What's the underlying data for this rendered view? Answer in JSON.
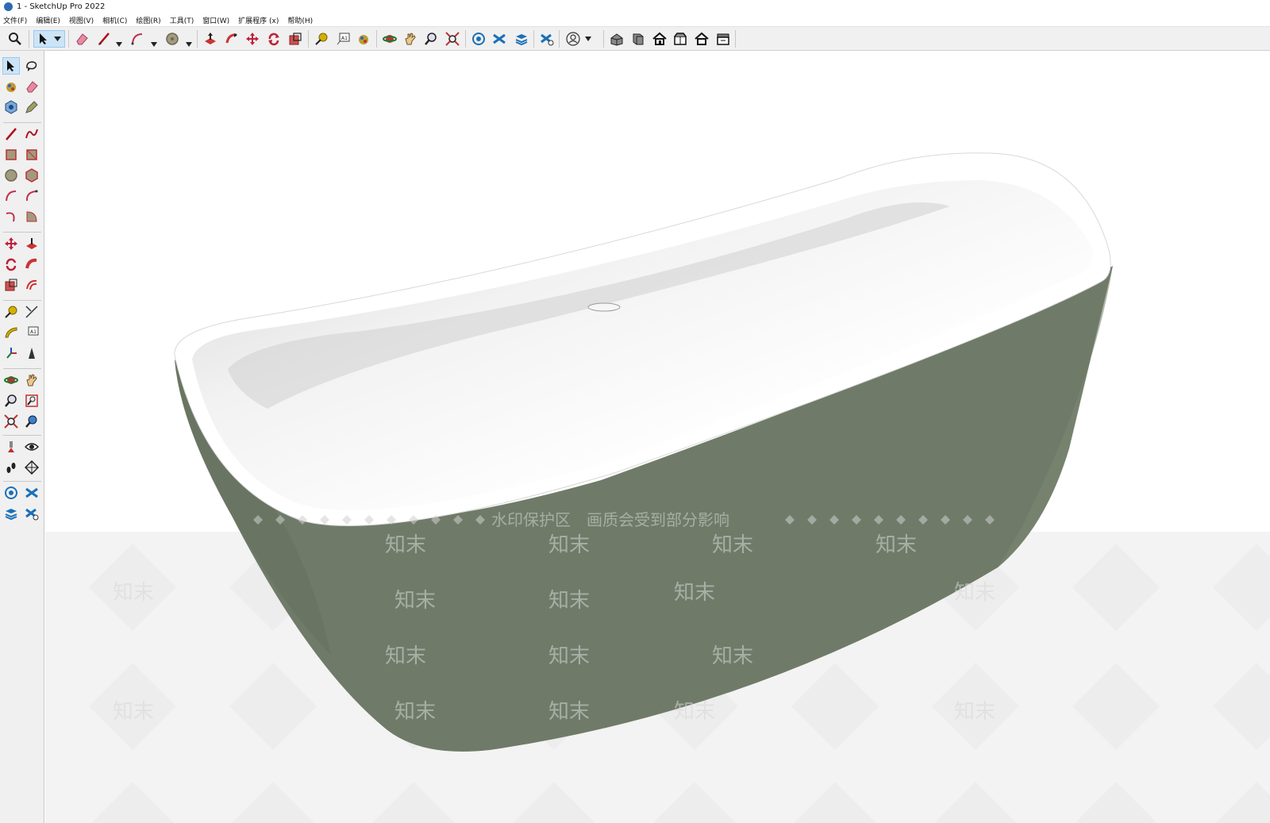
{
  "window": {
    "title": "1 - SketchUp Pro 2022"
  },
  "menu": [
    "文件(F)",
    "编辑(E)",
    "视图(V)",
    "相机(C)",
    "绘图(R)",
    "工具(T)",
    "窗口(W)",
    "扩展程序 (x)",
    "帮助(H)"
  ],
  "toolbar_icons": [
    "search-icon",
    "select-icon",
    "eraser-icon",
    "line-icon",
    "arc-icon",
    "paint-bucket-icon",
    "push-pull-icon",
    "follow-me-icon",
    "move-icon",
    "rotate-icon",
    "scale-icon",
    "tape-measure-icon",
    "text-icon",
    "paint-icon",
    "orbit-icon",
    "pan-icon",
    "zoom-icon",
    "zoom-extents-icon",
    "warehouse-icon",
    "extension-icon",
    "layers-icon",
    "sandbox-icon",
    "profile-icon",
    "iso-view-icon",
    "front-view-icon",
    "home-view-icon",
    "top-view-icon",
    "house-icon",
    "back-view-icon"
  ],
  "colors": {
    "tub_body": "#6f7b68",
    "tub_inner": "#ffffff",
    "ground": "#f3f3f3",
    "toolbar_bg": "#f0f0f0",
    "select_highlight": "#cce4f7"
  },
  "watermark": {
    "banner": "水印保护区　画质会受到部分影响",
    "brand": "知末"
  }
}
